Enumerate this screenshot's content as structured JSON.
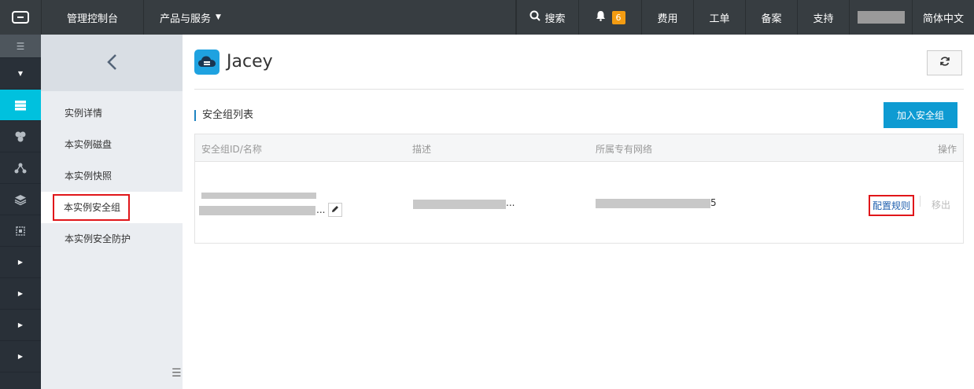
{
  "topbar": {
    "logo_icon": "aliyun-logo-icon",
    "console": "管理控制台",
    "products": "产品与服务",
    "search": "搜索",
    "notifications_count": "6",
    "fee": "费用",
    "ticket": "工单",
    "beian": "备案",
    "support": "支持",
    "language": "简体中文"
  },
  "rail": {
    "icons": [
      "menu-icon",
      "caret-down-icon",
      "server-icon",
      "cluster-icon",
      "network-icon",
      "layers-icon",
      "chip-icon",
      "caret-right-icon",
      "caret-right-icon",
      "caret-right-icon",
      "caret-right-icon"
    ]
  },
  "subnav": {
    "items": [
      {
        "label": "实例详情"
      },
      {
        "label": "本实例磁盘"
      },
      {
        "label": "本实例快照"
      },
      {
        "label": "本实例安全组"
      },
      {
        "label": "本实例安全防护"
      }
    ]
  },
  "main": {
    "title": "Jacey",
    "section_title": "安全组列表",
    "add_button": "加入安全组",
    "table": {
      "headers": [
        "安全组ID/名称",
        "描述",
        "所属专有网络",
        "操作"
      ],
      "row": {
        "id_ellipsis": "...",
        "desc_ellipsis": "...",
        "vpc_suffix": "5",
        "action_config": "配置规则",
        "action_remove": "移出"
      }
    }
  },
  "colors": {
    "topbar": "#373d41",
    "rail": "#293038",
    "rail_active": "#00c1de",
    "primary_button": "#0e9bd2",
    "highlight_box": "#e0161a"
  }
}
